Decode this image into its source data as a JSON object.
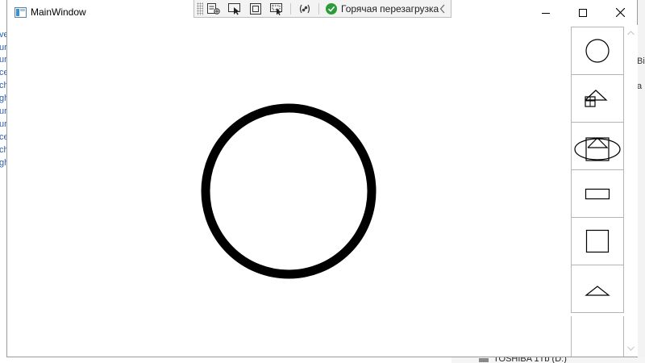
{
  "window": {
    "title": "MainWindow",
    "minimize_icon": "minimize-icon",
    "maximize_icon": "maximize-icon",
    "close_icon": "close-icon"
  },
  "debug_toolbar": {
    "hot_reload_label": "Горячая перезагрузка",
    "tools": [
      "live-visual-tree-icon",
      "select-element-icon",
      "display-layout-adorners-icon",
      "track-focused-element-icon",
      "binding-failures-icon"
    ],
    "status_icon": "checkmark-circle-icon",
    "collapse_icon": "chevron-left-icon"
  },
  "canvas": {
    "shape": "circle",
    "stroke_color": "#000000",
    "fill_color": "#ffffff"
  },
  "palette": {
    "items": [
      {
        "name": "circle",
        "icon": "circle-shape-icon"
      },
      {
        "name": "house",
        "icon": "house-shape-icon"
      },
      {
        "name": "ellipse-house",
        "icon": "ellipse-house-shape-icon"
      },
      {
        "name": "rectangle",
        "icon": "rectangle-shape-icon"
      },
      {
        "name": "square",
        "icon": "square-shape-icon"
      },
      {
        "name": "triangle",
        "icon": "triangle-shape-icon"
      }
    ]
  },
  "background": {
    "left_fragments": [
      "ve",
      "ur",
      "ur",
      "ce",
      "ch",
      "gh",
      "ur",
      "ur",
      "ce",
      "ch",
      "gh"
    ],
    "right_fragments": [
      "Bi",
      "a"
    ],
    "drive_label": "TOSHIBA 1Tb (D:)"
  },
  "colors": {
    "accent_green": "#2c9b3a",
    "border": "#b5b5b5",
    "link_blue": "#2b5fb4"
  }
}
